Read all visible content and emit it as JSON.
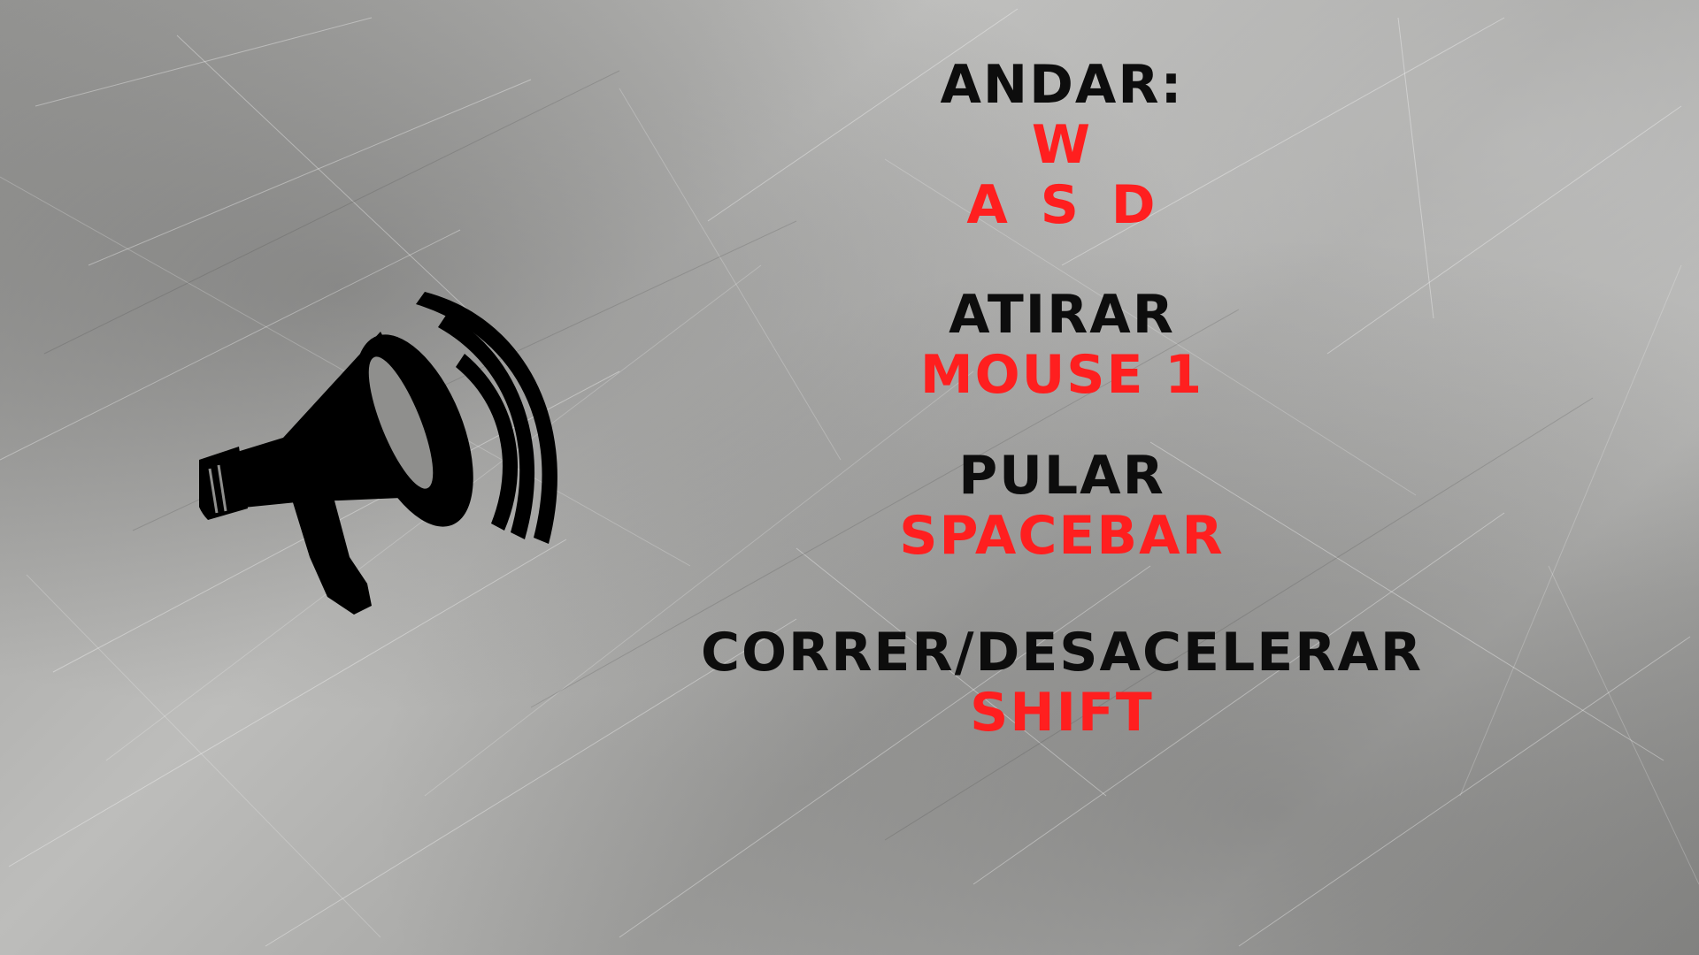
{
  "controls": [
    {
      "action": "ANDAR:",
      "keys": [
        "W",
        "A S D"
      ]
    },
    {
      "action": "ATIRAR",
      "keys": [
        "MOUSE 1"
      ]
    },
    {
      "action": "PULAR",
      "keys": [
        "SPACEBAR"
      ]
    },
    {
      "action": "CORRER/DESACELERAR",
      "keys": [
        "SHIFT"
      ]
    }
  ],
  "colors": {
    "action_text": "#0d0d0d",
    "key_text": "#ff1f1f",
    "background": "#a8a8a6"
  },
  "icons": {
    "announcement": "megaphone-icon"
  }
}
